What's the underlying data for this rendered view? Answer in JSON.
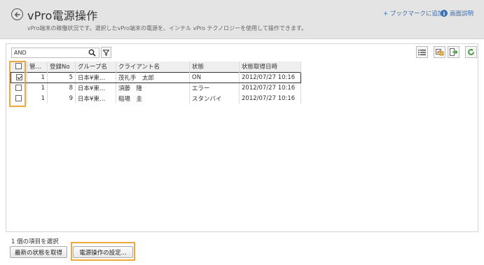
{
  "header": {
    "title": "vPro電源操作",
    "subtitle": "vPro端末の稼働状況です。選択したvPro端末の電源を、インテル vPro テクノロジーを使用して操作できます。",
    "bookmark_label": "+ ブックマークに追加",
    "help_label": "画面説明"
  },
  "search": {
    "value": "AND"
  },
  "table": {
    "columns": [
      "管…",
      "登録No",
      "グループ名",
      "クライアント名",
      "状態",
      "状態取得日時"
    ],
    "rows": [
      {
        "checked": true,
        "kan": "1",
        "no": "5",
        "group": "日本¥東…",
        "client": "茂礼手　太郎",
        "state": "ON",
        "date": "2012/07/27 10:16"
      },
      {
        "checked": false,
        "kan": "1",
        "no": "8",
        "group": "日本¥東…",
        "client": "須藤　隆",
        "state": "エラー",
        "date": "2012/07/27 10:16"
      },
      {
        "checked": false,
        "kan": "1",
        "no": "9",
        "group": "日本¥東…",
        "client": "稲場　圭",
        "state": "スタンバイ",
        "date": "2012/07/27 10:16"
      }
    ]
  },
  "footer": {
    "status": "1 個の項目を選択",
    "refresh_label": "最新の状態を取得",
    "settings_label": "電源操作の設定..."
  },
  "colors": {
    "highlight": "#f1a83a",
    "link": "#3a6fb0",
    "header_bg": "#e4e4e4"
  },
  "icons": [
    "back-arrow-icon",
    "info-icon",
    "search-icon",
    "filter-icon",
    "list-view-icon",
    "select-check-icon",
    "export-icon",
    "refresh-icon"
  ]
}
